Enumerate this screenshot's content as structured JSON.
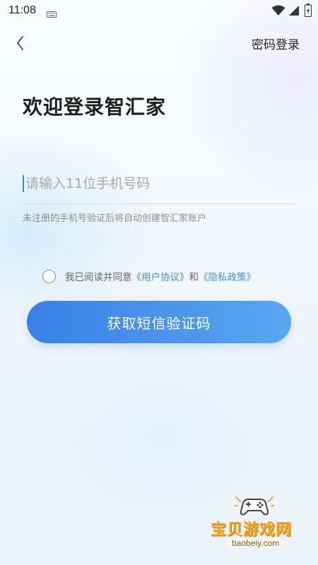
{
  "status_bar": {
    "time": "11:08",
    "icons": [
      "keyboard-icon",
      "wifi-icon",
      "signal-icon",
      "battery-icon"
    ]
  },
  "header": {
    "back_icon": "chevron-left-icon",
    "password_login_label": "密码登录"
  },
  "main": {
    "title": "欢迎登录智汇家",
    "phone_input": {
      "placeholder": "请输入11位手机号码",
      "value": ""
    },
    "hint": "未注册的手机号验证后将自动创建智汇家账户",
    "agreement": {
      "checked": false,
      "prefix": "我已阅读并同意",
      "user_agreement": "《用户协议》",
      "and": "和",
      "privacy_policy": "《隐私政策》"
    },
    "submit_label": "获取短信验证码"
  },
  "watermark": {
    "title": "宝贝游戏网",
    "url": "baobeiy.com"
  },
  "colors": {
    "accent_start": "#3a80e6",
    "accent_end": "#5aa6f0",
    "link": "#3d8fe0",
    "cursor": "#1aa39a",
    "watermark": "#f5a623"
  }
}
